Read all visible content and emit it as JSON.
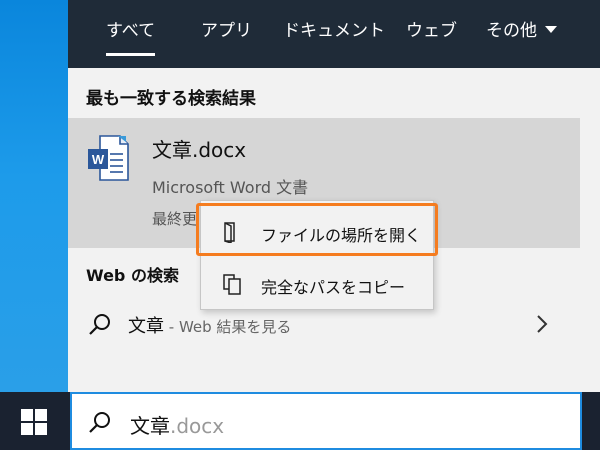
{
  "tabs": [
    {
      "label": "すべて",
      "active": true
    },
    {
      "label": "アプリ",
      "active": false
    },
    {
      "label": "ドキュメント",
      "active": false
    },
    {
      "label": "ウェブ",
      "active": false
    },
    {
      "label": "その他",
      "active": false
    }
  ],
  "best_match": {
    "heading": "最も一致する検索結果",
    "title": "文章.docx",
    "subtitle": "Microsoft Word 文書",
    "date_label": "最終更",
    "icon": "word-document-icon"
  },
  "context_menu": {
    "open_location": "ファイルの場所を開く",
    "copy_path": "完全なパスをコピー",
    "highlight_color": "#f57c1f"
  },
  "web": {
    "heading": "Web の検索",
    "query": "文章",
    "suffix": " - Web 結果を見る"
  },
  "searchbox": {
    "typed": "文章",
    "completion": ".docx"
  },
  "colors": {
    "tab_bar": "#1f2b38",
    "selected_result": "#d6d6d6",
    "taskbar": "#1a2230",
    "accent": "#1f8ce0"
  }
}
